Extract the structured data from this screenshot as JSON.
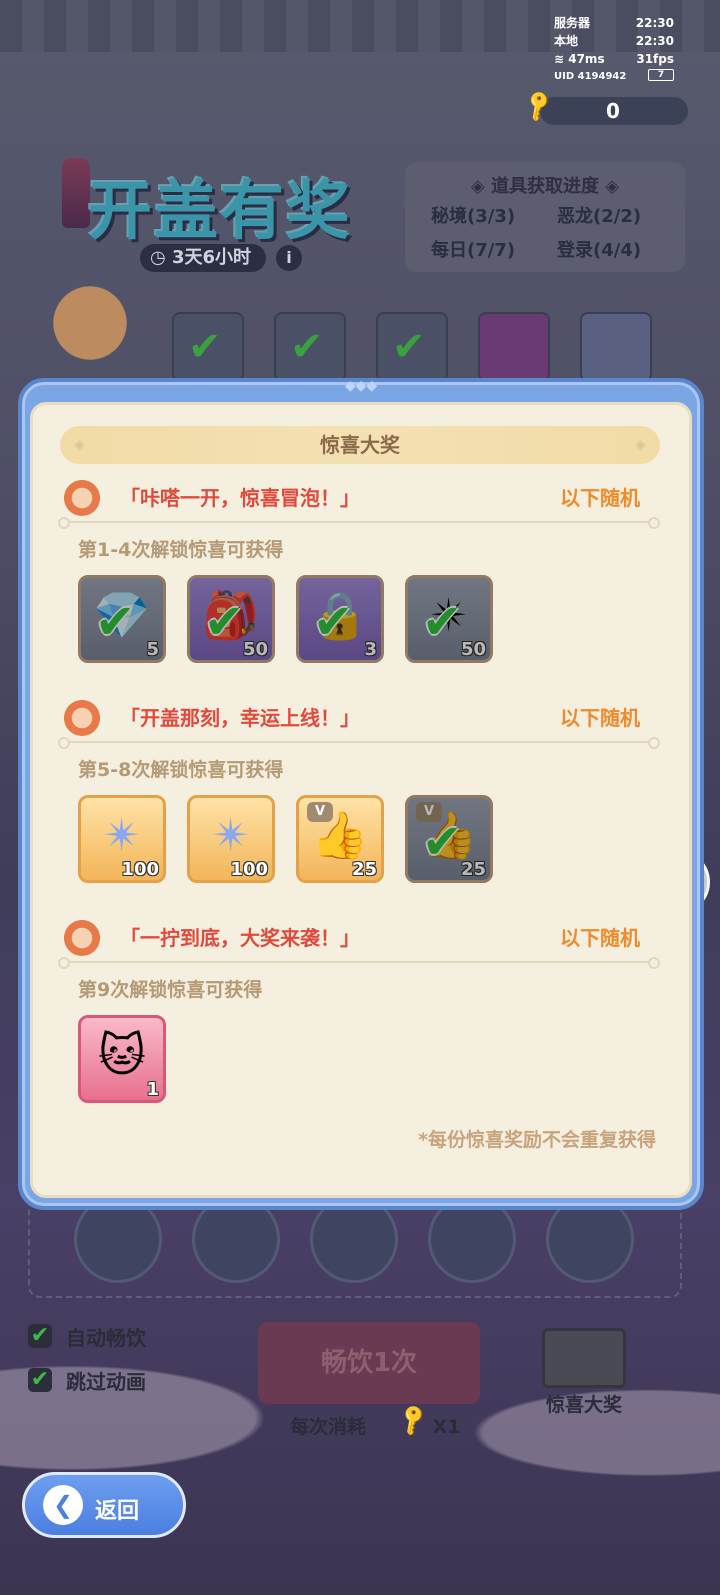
{
  "hud": {
    "server_label": "服务器",
    "server_time": "22:30",
    "local_label": "本地",
    "local_time": "22:30",
    "ping": "47ms",
    "fps": "31fps",
    "uid": "UID 4194942",
    "battery": "7"
  },
  "key_count": "0",
  "event": {
    "title": "开盖有奖",
    "timer": "3天6小时",
    "info_icon": "i"
  },
  "progress": {
    "header": "◈ 道具获取进度 ◈",
    "secret_realm": "秘境(3/3)",
    "dragon": "恶龙(2/2)",
    "daily": "每日(7/7)",
    "login": "登录(4/4)"
  },
  "modal": {
    "title": "惊喜大奖",
    "random_label": "以下随机",
    "note": "*每份惊喜奖励不会重复获得",
    "sections": [
      {
        "quote": "「咔嗒一开，惊喜冒泡！」",
        "unlock": "第1-4次解锁惊喜可获得",
        "items": [
          {
            "icon": "crystal-icon",
            "count": "5",
            "claimed": true
          },
          {
            "icon": "chest-icon",
            "count": "50",
            "claimed": true
          },
          {
            "icon": "lock-icon",
            "count": "3",
            "claimed": true
          },
          {
            "icon": "star-crystal-icon",
            "count": "50",
            "claimed": true
          }
        ]
      },
      {
        "quote": "「开盖那刻，幸运上线！」",
        "unlock": "第5-8次解锁惊喜可获得",
        "items": [
          {
            "icon": "star-crystal-icon",
            "count": "100",
            "claimed": false
          },
          {
            "icon": "star-crystal-icon",
            "count": "100",
            "claimed": false
          },
          {
            "icon": "thumbs-up-icon",
            "count": "25",
            "badge": "V",
            "claimed": false
          },
          {
            "icon": "thumbs-up-icon",
            "count": "25",
            "badge": "V",
            "claimed": true
          }
        ]
      },
      {
        "quote": "「一拧到底，大奖来袭！」",
        "unlock": "第9次解锁惊喜可获得",
        "items": [
          {
            "icon": "cat-avatar-icon",
            "count": "1",
            "claimed": false
          }
        ]
      }
    ]
  },
  "options": {
    "auto_drink": "自动畅饮",
    "skip_anim": "跳过动画"
  },
  "drink_button": "畅饮1次",
  "cost": {
    "label": "每次消耗",
    "amount": "X1"
  },
  "prize_label": "惊喜大奖",
  "back_label": "返回"
}
